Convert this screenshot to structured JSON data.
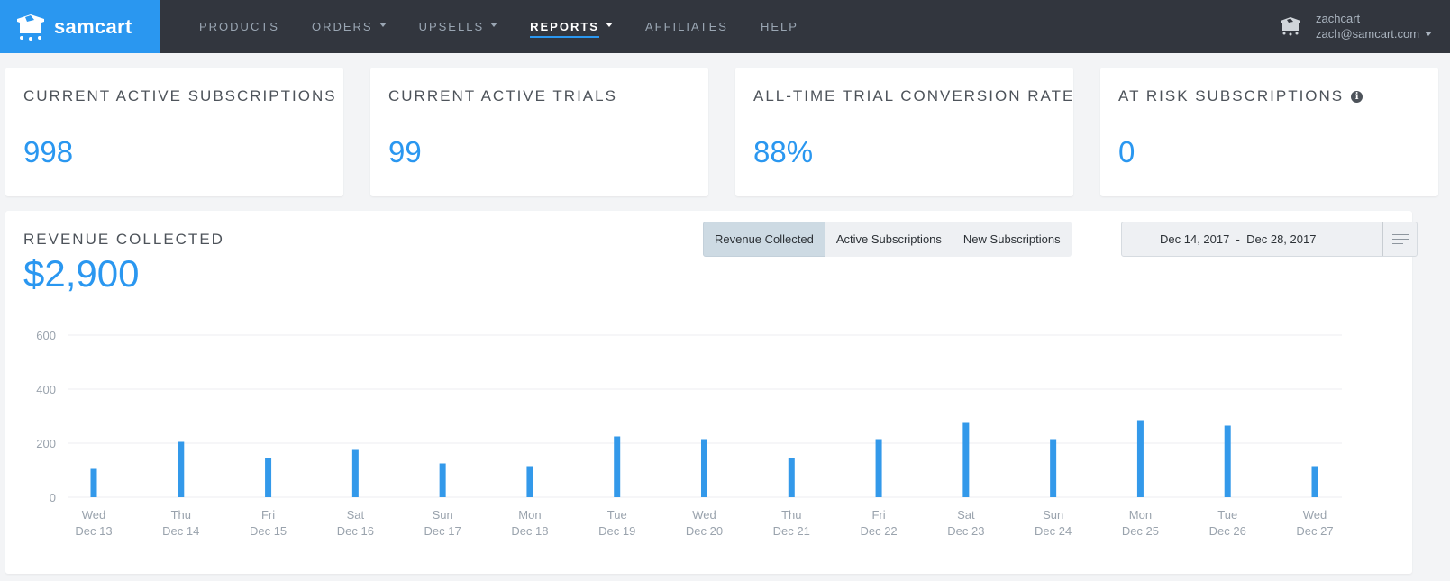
{
  "brand": {
    "name": "samcart",
    "color": "#2a97f0"
  },
  "nav": {
    "items": [
      {
        "label": "PRODUCTS",
        "dropdown": false,
        "active": false
      },
      {
        "label": "ORDERS",
        "dropdown": true,
        "active": false
      },
      {
        "label": "UPSELLS",
        "dropdown": true,
        "active": false
      },
      {
        "label": "REPORTS",
        "dropdown": true,
        "active": true
      },
      {
        "label": "AFFILIATES",
        "dropdown": false,
        "active": false
      },
      {
        "label": "HELP",
        "dropdown": false,
        "active": false
      }
    ]
  },
  "user": {
    "username": "zachcart",
    "email": "zach@samcart.com"
  },
  "stats": [
    {
      "title": "CURRENT ACTIVE SUBSCRIPTIONS",
      "value": "998"
    },
    {
      "title": "CURRENT ACTIVE TRIALS",
      "value": "99"
    },
    {
      "title": "ALL-TIME TRIAL CONVERSION RATE",
      "value": "88%"
    },
    {
      "title": "AT RISK SUBSCRIPTIONS",
      "value": "0",
      "info_icon": "info-icon"
    }
  ],
  "revenue": {
    "title": "REVENUE COLLECTED",
    "amount": "$2,900",
    "tabs": [
      {
        "label": "Revenue Collected",
        "active": true
      },
      {
        "label": "Active Subscriptions",
        "active": false
      },
      {
        "label": "New Subscriptions",
        "active": false
      }
    ],
    "date_range": "Dec 14, 2017  -  Dec 28, 2017"
  },
  "chart_data": {
    "type": "bar",
    "title": "",
    "xlabel": "",
    "ylabel": "",
    "ylim": [
      0,
      600
    ],
    "yticks": [
      0,
      200,
      400,
      600
    ],
    "grid": true,
    "bar_color": "#3399ea",
    "categories": [
      {
        "day": "Wed",
        "date": "Dec 13"
      },
      {
        "day": "Thu",
        "date": "Dec 14"
      },
      {
        "day": "Fri",
        "date": "Dec 15"
      },
      {
        "day": "Sat",
        "date": "Dec 16"
      },
      {
        "day": "Sun",
        "date": "Dec 17"
      },
      {
        "day": "Mon",
        "date": "Dec 18"
      },
      {
        "day": "Tue",
        "date": "Dec 19"
      },
      {
        "day": "Wed",
        "date": "Dec 20"
      },
      {
        "day": "Thu",
        "date": "Dec 21"
      },
      {
        "day": "Fri",
        "date": "Dec 22"
      },
      {
        "day": "Sat",
        "date": "Dec 23"
      },
      {
        "day": "Sun",
        "date": "Dec 24"
      },
      {
        "day": "Mon",
        "date": "Dec 25"
      },
      {
        "day": "Tue",
        "date": "Dec 26"
      },
      {
        "day": "Wed",
        "date": "Dec 27"
      }
    ],
    "values": [
      105,
      205,
      145,
      175,
      125,
      115,
      225,
      215,
      145,
      215,
      275,
      215,
      285,
      265,
      115
    ]
  }
}
